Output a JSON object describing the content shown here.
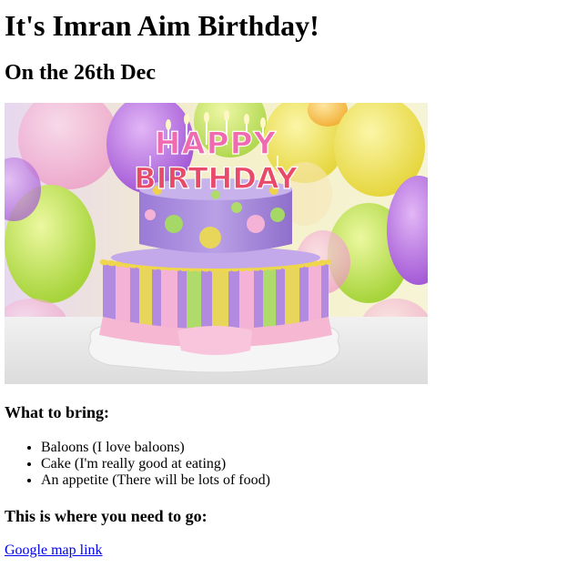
{
  "title": "It's Imran Aim Birthday!",
  "subtitle": "On the 26th Dec",
  "image": {
    "cake_text_top": "HAPPY",
    "cake_text_bottom": "BIRTHDAY"
  },
  "bring": {
    "heading": "What to bring:",
    "items": [
      "Baloons (I love baloons)",
      "Cake (I'm really good at eating)",
      "An appetite (There will be lots of food)"
    ]
  },
  "directions": {
    "heading": "This is where you need to go:",
    "link_text": "Google map link"
  },
  "colors": {
    "link": "#0000ee",
    "text": "#000000",
    "background": "#ffffff"
  }
}
